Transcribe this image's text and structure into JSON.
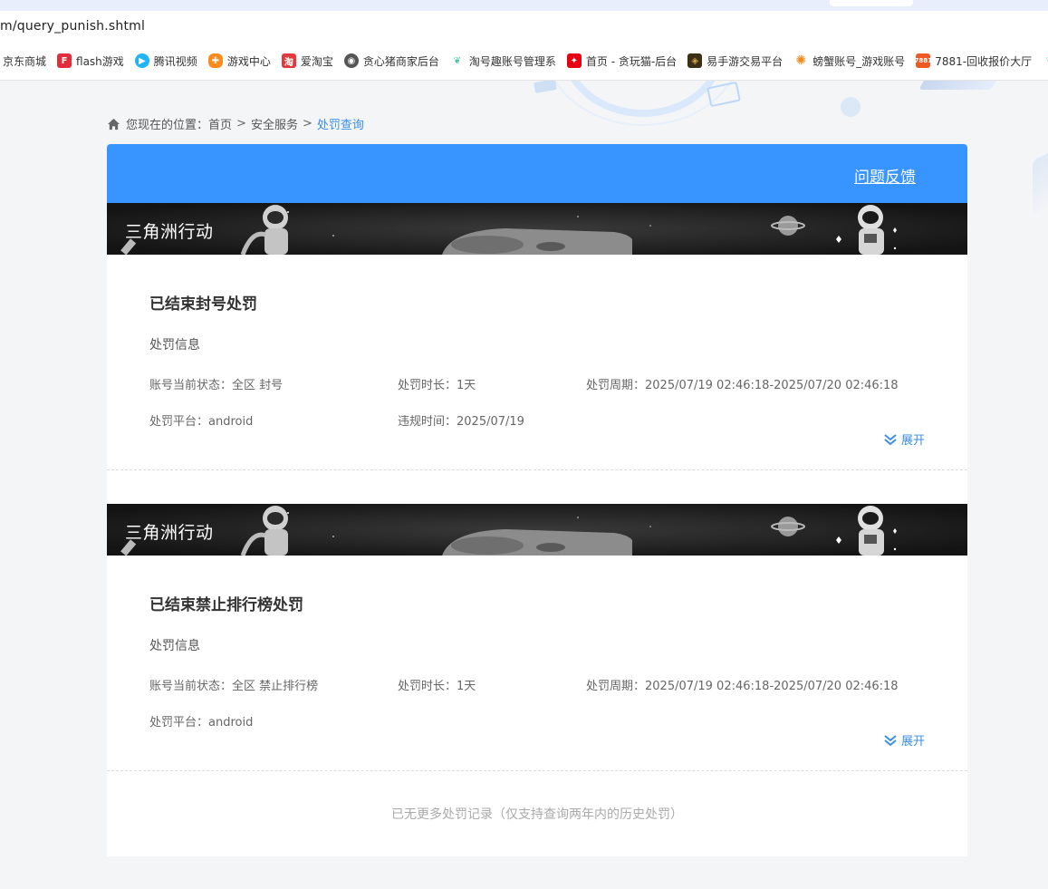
{
  "browser": {
    "url": "m/query_punish.shtml",
    "bookmarks": [
      {
        "label": "京东商城",
        "icon": "jd-icon",
        "color": ""
      },
      {
        "label": "flash游戏",
        "icon": "flash-game-icon",
        "color": "#e02e3c"
      },
      {
        "label": "腾讯视频",
        "icon": "tencent-video-icon",
        "color": "#1fb4f5"
      },
      {
        "label": "游戏中心",
        "icon": "game-center-icon",
        "color": "#ff8b1f"
      },
      {
        "label": "爱淘宝",
        "icon": "taobao-icon",
        "color": "#e4393c"
      },
      {
        "label": "贪心猪商家后台",
        "icon": "globe-icon",
        "color": "#555555"
      },
      {
        "label": "淘号趣账号管理系",
        "icon": "leaf-icon",
        "color": "#4cc5a3"
      },
      {
        "label": "首页 - 贪玩猫-后台",
        "icon": "tanwanmao-icon",
        "color": "#e60012"
      },
      {
        "label": "易手游交易平台",
        "icon": "yishouyou-icon",
        "color": "#7a5b1e"
      },
      {
        "label": "螃蟹账号_游戏账号",
        "icon": "crab-icon",
        "color": "#f08a1c"
      },
      {
        "label": "7881-回收报价大厅",
        "icon": "7881-icon",
        "color": "#ee5a24"
      }
    ]
  },
  "breadcrumb": {
    "prefix": "您现在的位置：",
    "items": [
      "首页",
      "安全服务",
      "处罚查询"
    ],
    "sep": ">"
  },
  "header": {
    "feedback_label": "问题反馈"
  },
  "records": [
    {
      "game": "三角洲行动",
      "title": "已结束封号处罚",
      "subtitle": "处罚信息",
      "status": "账号当前状态：全区 封号",
      "duration": "处罚时长：1天",
      "period": "处罚周期：2025/07/19 02:46:18-2025/07/20 02:46:18",
      "platform": "处罚平台：android",
      "violation_time": "违规时间：2025/07/19",
      "expand_label": "展开"
    },
    {
      "game": "三角洲行动",
      "title": "已结束禁止排行榜处罚",
      "subtitle": "处罚信息",
      "status": "账号当前状态：全区 禁止排行榜",
      "duration": "处罚时长：1天",
      "period": "处罚周期：2025/07/19 02:46:18-2025/07/20 02:46:18",
      "platform": "处罚平台：android",
      "violation_time": "",
      "expand_label": "展开"
    }
  ],
  "footer": {
    "note": "已无更多处罚记录（仅支持查询两年内的历史处罚）"
  },
  "colors": {
    "accent": "#3894ff",
    "link": "#3a8ee6"
  }
}
